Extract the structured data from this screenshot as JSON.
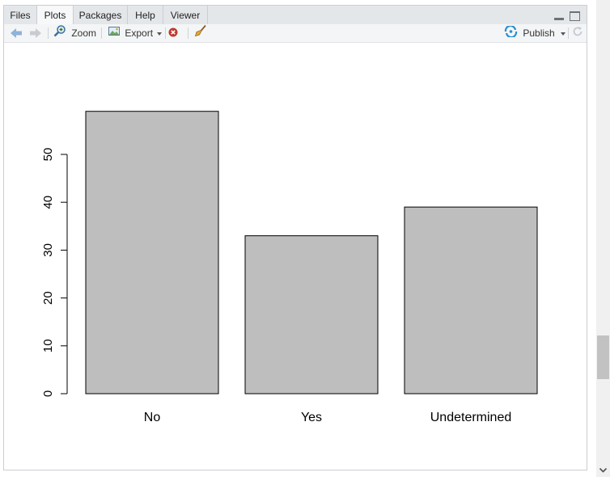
{
  "tabs": [
    {
      "label": "Files"
    },
    {
      "label": "Plots"
    },
    {
      "label": "Packages"
    },
    {
      "label": "Help"
    },
    {
      "label": "Viewer"
    }
  ],
  "toolbar": {
    "zoom_label": "Zoom",
    "export_label": "Export",
    "publish_label": "Publish"
  },
  "colors": {
    "bar_fill": "#bebebe",
    "accent": "#4a90d9"
  },
  "chart_data": {
    "type": "bar",
    "categories": [
      "No",
      "Yes",
      "Undetermined"
    ],
    "values": [
      59,
      33,
      39
    ],
    "title": "",
    "xlabel": "",
    "ylabel": "",
    "ylim": [
      0,
      59
    ],
    "yticks": [
      0,
      10,
      20,
      30,
      40,
      50
    ],
    "grid": false
  }
}
